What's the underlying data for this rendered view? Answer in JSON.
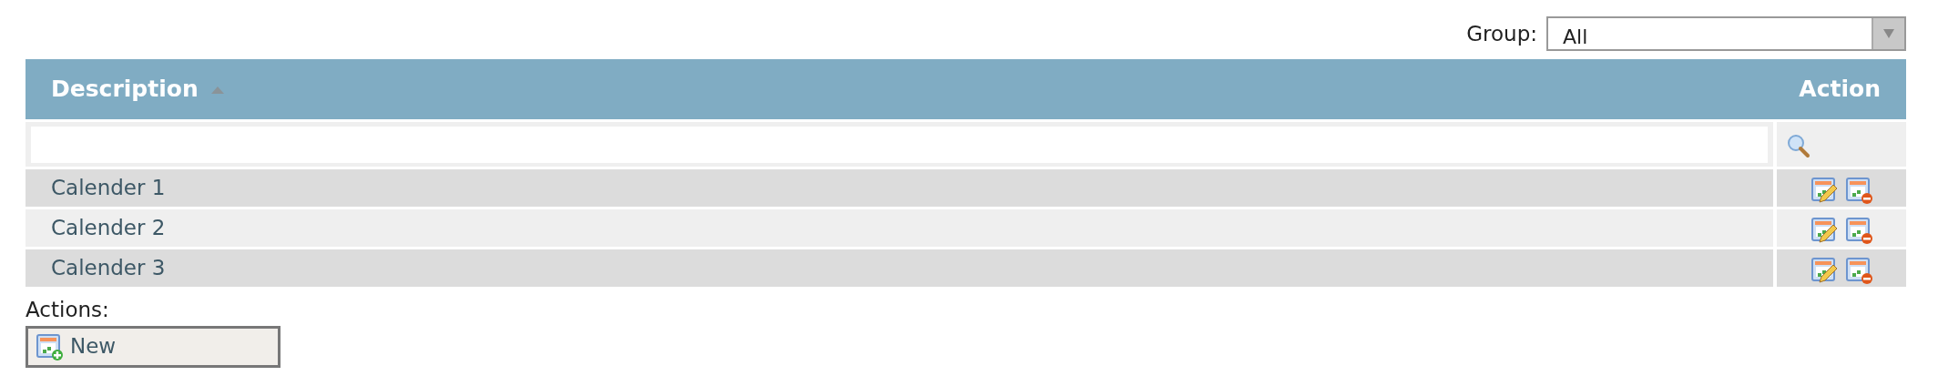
{
  "group_filter": {
    "label": "Group:",
    "value": "All"
  },
  "table": {
    "columns": [
      {
        "label": "Description",
        "sorted": true
      },
      {
        "label": "Action"
      }
    ],
    "rows": [
      {
        "description": "Calender 1"
      },
      {
        "description": "Calender 2"
      },
      {
        "description": "Calender 3"
      }
    ]
  },
  "actions": {
    "label": "Actions:",
    "buttons": [
      "New"
    ]
  }
}
